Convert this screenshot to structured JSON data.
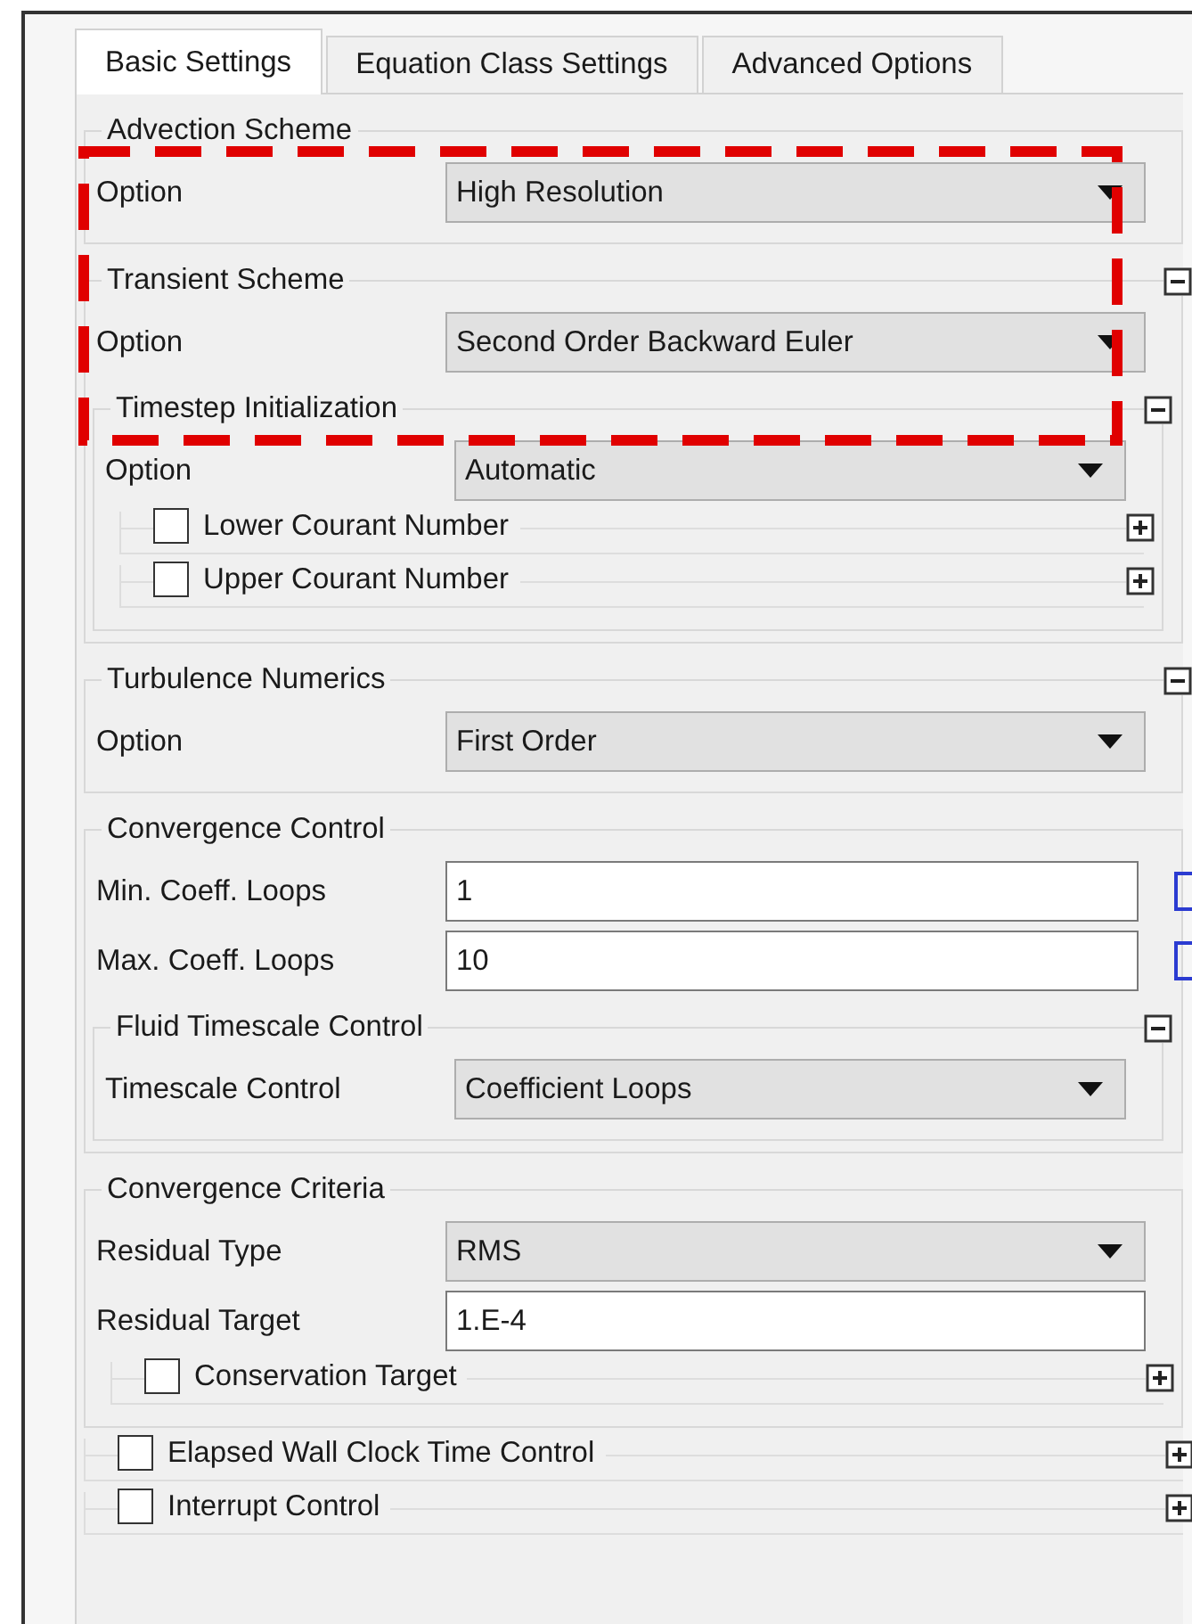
{
  "tabs": [
    {
      "label": "Basic Settings",
      "selected": true
    },
    {
      "label": "Equation Class Settings",
      "selected": false
    },
    {
      "label": "Advanced Options",
      "selected": false
    }
  ],
  "sections": [
    {
      "kind": "group",
      "title": "Advection Scheme",
      "children": [
        {
          "kind": "dropdown",
          "label": "Option",
          "value": "High Resolution"
        }
      ]
    },
    {
      "kind": "group",
      "title": "Transient Scheme",
      "expanded": true,
      "children": [
        {
          "kind": "dropdown",
          "label": "Option",
          "value": "Second Order Backward Euler"
        },
        {
          "kind": "group",
          "title": "Timestep Initialization",
          "expanded": true,
          "children": [
            {
              "kind": "dropdown",
              "label": "Option",
              "value": "Automatic"
            },
            {
              "kind": "option_group",
              "title": "Lower Courant Number",
              "checked": false,
              "expanded": false
            },
            {
              "kind": "option_group",
              "title": "Upper Courant Number",
              "checked": false,
              "expanded": false
            }
          ]
        }
      ]
    },
    {
      "kind": "group",
      "title": "Turbulence Numerics",
      "expanded": true,
      "children": [
        {
          "kind": "dropdown",
          "label": "Option",
          "value": "First Order"
        }
      ]
    },
    {
      "kind": "group",
      "title": "Convergence Control",
      "children": [
        {
          "kind": "number",
          "label": "Min. Coeff. Loops",
          "value": "1",
          "expression_button": true
        },
        {
          "kind": "number",
          "label": "Max. Coeff. Loops",
          "value": "10",
          "expression_button": true
        },
        {
          "kind": "group",
          "title": "Fluid Timescale Control",
          "expanded": true,
          "children": [
            {
              "kind": "dropdown",
              "label": "Timescale Control",
              "value": "Coefficient Loops"
            }
          ]
        }
      ]
    },
    {
      "kind": "group",
      "title": "Convergence Criteria",
      "children": [
        {
          "kind": "dropdown",
          "label": "Residual Type",
          "value": "RMS"
        },
        {
          "kind": "number",
          "label": "Residual Target",
          "value": "1.E-4"
        },
        {
          "kind": "option_group",
          "title": "Conservation Target",
          "checked": false,
          "expanded": false
        }
      ]
    },
    {
      "kind": "option_group",
      "title": "Elapsed Wall Clock Time Control",
      "checked": false,
      "expanded": false
    },
    {
      "kind": "option_group",
      "title": "Interrupt Control",
      "checked": false,
      "expanded": false
    }
  ]
}
